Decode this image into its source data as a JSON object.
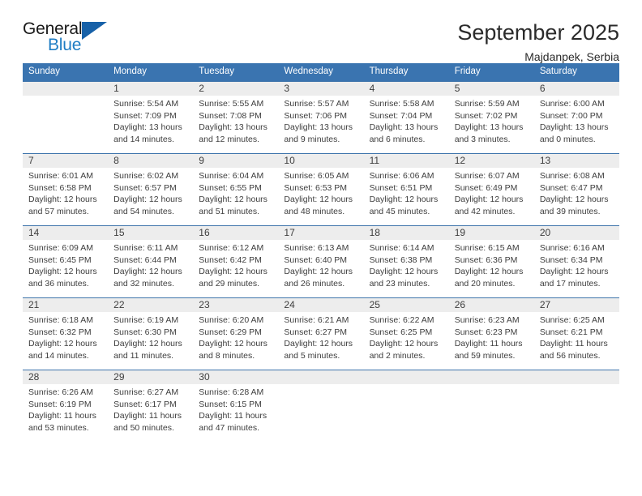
{
  "brand": {
    "name_part1": "General",
    "name_part2": "Blue",
    "triangle_color": "#1761a8",
    "blue_color": "#1f7dc4"
  },
  "header": {
    "title": "September 2025",
    "subtitle": "Majdanpek, Serbia"
  },
  "theme": {
    "header_blue": "#3a74b0",
    "row_line_blue": "#3e74ab",
    "daynum_band": "#ededed"
  },
  "weekday_headers": [
    "Sunday",
    "Monday",
    "Tuesday",
    "Wednesday",
    "Thursday",
    "Friday",
    "Saturday"
  ],
  "labels": {
    "sunrise_prefix": "Sunrise:",
    "sunset_prefix": "Sunset:",
    "daylight_prefix": "Daylight:"
  },
  "weeks": [
    [
      {
        "day": "",
        "blank": true,
        "sunrise": "",
        "sunset": "",
        "daylight_line1": "",
        "daylight_line2": ""
      },
      {
        "day": "1",
        "sunrise": "Sunrise: 5:54 AM",
        "sunset": "Sunset: 7:09 PM",
        "daylight_line1": "Daylight: 13 hours",
        "daylight_line2": "and 14 minutes."
      },
      {
        "day": "2",
        "sunrise": "Sunrise: 5:55 AM",
        "sunset": "Sunset: 7:08 PM",
        "daylight_line1": "Daylight: 13 hours",
        "daylight_line2": "and 12 minutes."
      },
      {
        "day": "3",
        "sunrise": "Sunrise: 5:57 AM",
        "sunset": "Sunset: 7:06 PM",
        "daylight_line1": "Daylight: 13 hours",
        "daylight_line2": "and 9 minutes."
      },
      {
        "day": "4",
        "sunrise": "Sunrise: 5:58 AM",
        "sunset": "Sunset: 7:04 PM",
        "daylight_line1": "Daylight: 13 hours",
        "daylight_line2": "and 6 minutes."
      },
      {
        "day": "5",
        "sunrise": "Sunrise: 5:59 AM",
        "sunset": "Sunset: 7:02 PM",
        "daylight_line1": "Daylight: 13 hours",
        "daylight_line2": "and 3 minutes."
      },
      {
        "day": "6",
        "sunrise": "Sunrise: 6:00 AM",
        "sunset": "Sunset: 7:00 PM",
        "daylight_line1": "Daylight: 13 hours",
        "daylight_line2": "and 0 minutes."
      }
    ],
    [
      {
        "day": "7",
        "sunrise": "Sunrise: 6:01 AM",
        "sunset": "Sunset: 6:58 PM",
        "daylight_line1": "Daylight: 12 hours",
        "daylight_line2": "and 57 minutes."
      },
      {
        "day": "8",
        "sunrise": "Sunrise: 6:02 AM",
        "sunset": "Sunset: 6:57 PM",
        "daylight_line1": "Daylight: 12 hours",
        "daylight_line2": "and 54 minutes."
      },
      {
        "day": "9",
        "sunrise": "Sunrise: 6:04 AM",
        "sunset": "Sunset: 6:55 PM",
        "daylight_line1": "Daylight: 12 hours",
        "daylight_line2": "and 51 minutes."
      },
      {
        "day": "10",
        "sunrise": "Sunrise: 6:05 AM",
        "sunset": "Sunset: 6:53 PM",
        "daylight_line1": "Daylight: 12 hours",
        "daylight_line2": "and 48 minutes."
      },
      {
        "day": "11",
        "sunrise": "Sunrise: 6:06 AM",
        "sunset": "Sunset: 6:51 PM",
        "daylight_line1": "Daylight: 12 hours",
        "daylight_line2": "and 45 minutes."
      },
      {
        "day": "12",
        "sunrise": "Sunrise: 6:07 AM",
        "sunset": "Sunset: 6:49 PM",
        "daylight_line1": "Daylight: 12 hours",
        "daylight_line2": "and 42 minutes."
      },
      {
        "day": "13",
        "sunrise": "Sunrise: 6:08 AM",
        "sunset": "Sunset: 6:47 PM",
        "daylight_line1": "Daylight: 12 hours",
        "daylight_line2": "and 39 minutes."
      }
    ],
    [
      {
        "day": "14",
        "sunrise": "Sunrise: 6:09 AM",
        "sunset": "Sunset: 6:45 PM",
        "daylight_line1": "Daylight: 12 hours",
        "daylight_line2": "and 36 minutes."
      },
      {
        "day": "15",
        "sunrise": "Sunrise: 6:11 AM",
        "sunset": "Sunset: 6:44 PM",
        "daylight_line1": "Daylight: 12 hours",
        "daylight_line2": "and 32 minutes."
      },
      {
        "day": "16",
        "sunrise": "Sunrise: 6:12 AM",
        "sunset": "Sunset: 6:42 PM",
        "daylight_line1": "Daylight: 12 hours",
        "daylight_line2": "and 29 minutes."
      },
      {
        "day": "17",
        "sunrise": "Sunrise: 6:13 AM",
        "sunset": "Sunset: 6:40 PM",
        "daylight_line1": "Daylight: 12 hours",
        "daylight_line2": "and 26 minutes."
      },
      {
        "day": "18",
        "sunrise": "Sunrise: 6:14 AM",
        "sunset": "Sunset: 6:38 PM",
        "daylight_line1": "Daylight: 12 hours",
        "daylight_line2": "and 23 minutes."
      },
      {
        "day": "19",
        "sunrise": "Sunrise: 6:15 AM",
        "sunset": "Sunset: 6:36 PM",
        "daylight_line1": "Daylight: 12 hours",
        "daylight_line2": "and 20 minutes."
      },
      {
        "day": "20",
        "sunrise": "Sunrise: 6:16 AM",
        "sunset": "Sunset: 6:34 PM",
        "daylight_line1": "Daylight: 12 hours",
        "daylight_line2": "and 17 minutes."
      }
    ],
    [
      {
        "day": "21",
        "sunrise": "Sunrise: 6:18 AM",
        "sunset": "Sunset: 6:32 PM",
        "daylight_line1": "Daylight: 12 hours",
        "daylight_line2": "and 14 minutes."
      },
      {
        "day": "22",
        "sunrise": "Sunrise: 6:19 AM",
        "sunset": "Sunset: 6:30 PM",
        "daylight_line1": "Daylight: 12 hours",
        "daylight_line2": "and 11 minutes."
      },
      {
        "day": "23",
        "sunrise": "Sunrise: 6:20 AM",
        "sunset": "Sunset: 6:29 PM",
        "daylight_line1": "Daylight: 12 hours",
        "daylight_line2": "and 8 minutes."
      },
      {
        "day": "24",
        "sunrise": "Sunrise: 6:21 AM",
        "sunset": "Sunset: 6:27 PM",
        "daylight_line1": "Daylight: 12 hours",
        "daylight_line2": "and 5 minutes."
      },
      {
        "day": "25",
        "sunrise": "Sunrise: 6:22 AM",
        "sunset": "Sunset: 6:25 PM",
        "daylight_line1": "Daylight: 12 hours",
        "daylight_line2": "and 2 minutes."
      },
      {
        "day": "26",
        "sunrise": "Sunrise: 6:23 AM",
        "sunset": "Sunset: 6:23 PM",
        "daylight_line1": "Daylight: 11 hours",
        "daylight_line2": "and 59 minutes."
      },
      {
        "day": "27",
        "sunrise": "Sunrise: 6:25 AM",
        "sunset": "Sunset: 6:21 PM",
        "daylight_line1": "Daylight: 11 hours",
        "daylight_line2": "and 56 minutes."
      }
    ],
    [
      {
        "day": "28",
        "sunrise": "Sunrise: 6:26 AM",
        "sunset": "Sunset: 6:19 PM",
        "daylight_line1": "Daylight: 11 hours",
        "daylight_line2": "and 53 minutes."
      },
      {
        "day": "29",
        "sunrise": "Sunrise: 6:27 AM",
        "sunset": "Sunset: 6:17 PM",
        "daylight_line1": "Daylight: 11 hours",
        "daylight_line2": "and 50 minutes."
      },
      {
        "day": "30",
        "sunrise": "Sunrise: 6:28 AM",
        "sunset": "Sunset: 6:15 PM",
        "daylight_line1": "Daylight: 11 hours",
        "daylight_line2": "and 47 minutes."
      },
      {
        "day": "",
        "blank": true,
        "sunrise": "",
        "sunset": "",
        "daylight_line1": "",
        "daylight_line2": ""
      },
      {
        "day": "",
        "blank": true,
        "sunrise": "",
        "sunset": "",
        "daylight_line1": "",
        "daylight_line2": ""
      },
      {
        "day": "",
        "blank": true,
        "sunrise": "",
        "sunset": "",
        "daylight_line1": "",
        "daylight_line2": ""
      },
      {
        "day": "",
        "blank": true,
        "sunrise": "",
        "sunset": "",
        "daylight_line1": "",
        "daylight_line2": ""
      }
    ]
  ]
}
